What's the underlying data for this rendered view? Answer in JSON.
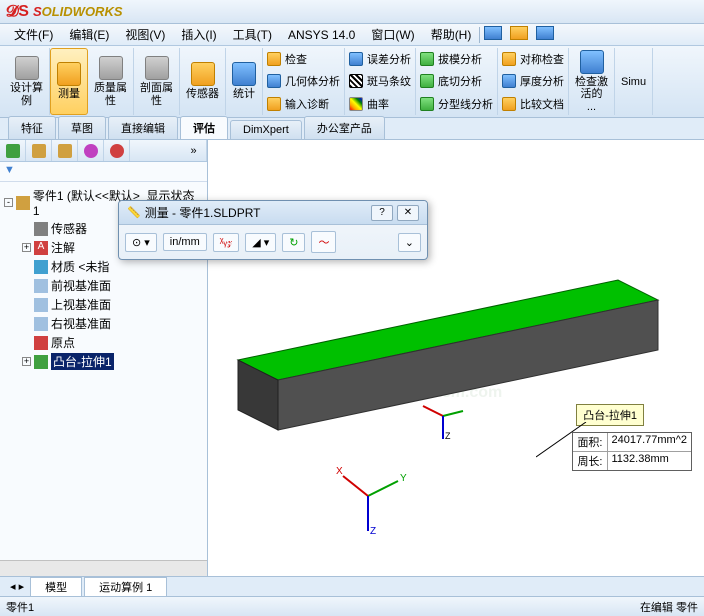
{
  "app": {
    "logo_s": "S",
    "logo_rest": "OLIDWORKS"
  },
  "menu": {
    "file": "文件(F)",
    "edit": "编辑(E)",
    "view": "视图(V)",
    "insert": "插入(I)",
    "tools": "工具(T)",
    "ansys": "ANSYS 14.0",
    "window": "窗口(W)",
    "help": "帮助(H)"
  },
  "ribbon": {
    "design": "设计算\n例",
    "measure": "测量",
    "mass": "质量属\n性",
    "section": "剖面属\n性",
    "sensor": "传感器",
    "stats": "统计",
    "check": "检查",
    "geom": "几何体分析",
    "diag": "输入诊断",
    "err": "误差分析",
    "zebra": "斑马条纹",
    "curve": "曲率",
    "draft": "拔模分析",
    "undercut": "底切分析",
    "parting": "分型线分析",
    "sym": "对称检查",
    "thick": "厚度分析",
    "compare": "比较文档",
    "checkdb": "检查激\n活的\n...",
    "simu": "Simu"
  },
  "tabs": {
    "feature": "特征",
    "sketch": "草图",
    "direct": "直接编辑",
    "eval": "评估",
    "dimx": "DimXpert",
    "office": "办公室产品"
  },
  "tree": {
    "root": "零件1  (默认<<默认>_显示状态 1",
    "sensors": "传感器",
    "annot": "注解",
    "material": "材质 <未指",
    "front": "前视基准面",
    "top": "上视基准面",
    "right": "右视基准面",
    "origin": "原点",
    "extrude": "凸台-拉伸1"
  },
  "floatwin": {
    "title": "测量 - 零件1.SLDPRT",
    "unit": "mm",
    "unit_in": "in"
  },
  "callout": {
    "label": "凸台-拉伸1"
  },
  "databox": {
    "area_lbl": "面积:",
    "area_val": "24017.77mm^2",
    "perim_lbl": "周长:",
    "perim_val": "1132.38mm"
  },
  "bottomtabs": {
    "model": "模型",
    "motion": "运动算例 1"
  },
  "status": {
    "part": "零件1",
    "mode": "在编辑 零件"
  },
  "filter": {
    "icon": "▼"
  }
}
